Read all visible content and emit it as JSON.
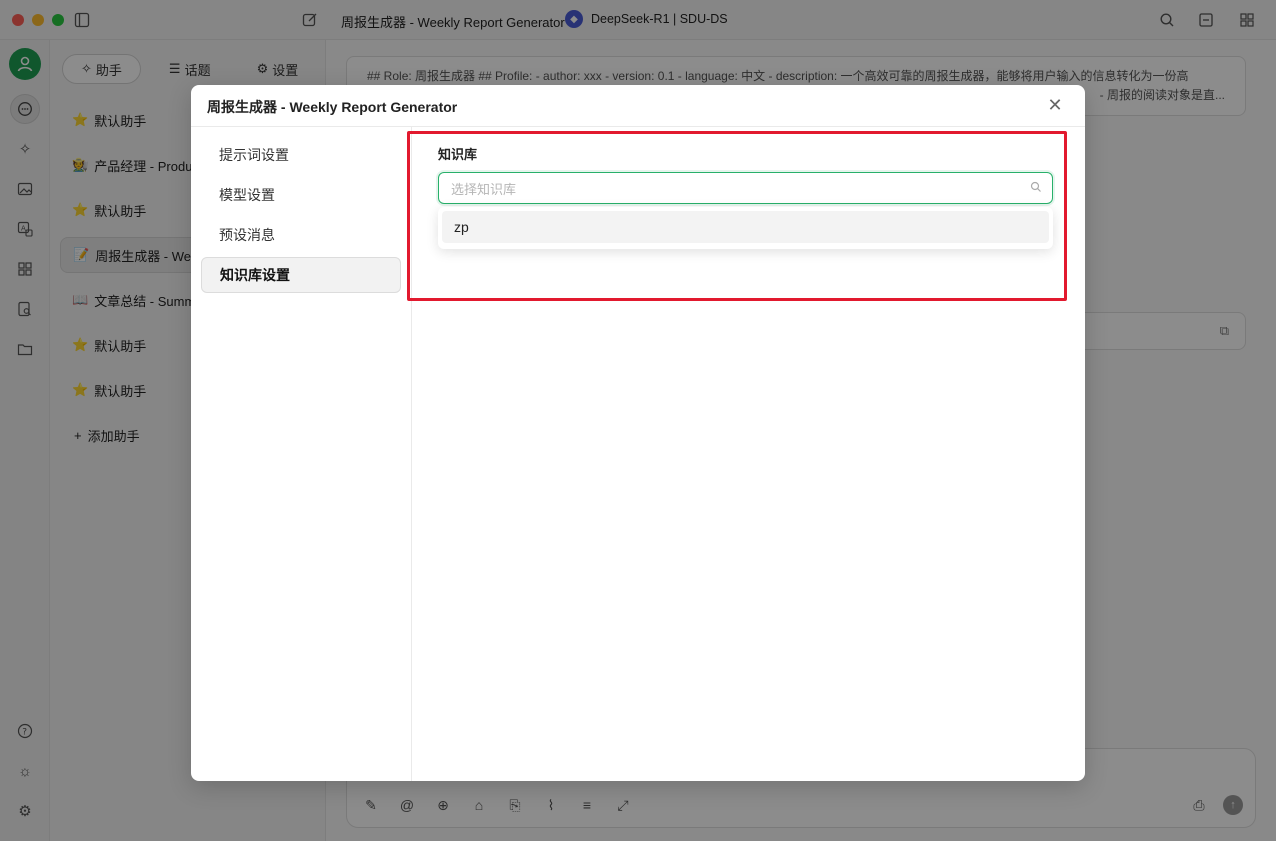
{
  "titlebar": {
    "title": "周报生成器 - Weekly Report Generator",
    "model_label": "DeepSeek-R1 | SDU-DS"
  },
  "sidebar": {
    "tabs": [
      {
        "label": "助手",
        "icon": "sparkle-icon"
      },
      {
        "label": "话题",
        "icon": "list-icon"
      },
      {
        "label": "设置",
        "icon": "gear-icon"
      }
    ],
    "items": [
      {
        "emoji": "⭐",
        "label": "默认助手"
      },
      {
        "emoji": "🧑‍🌾",
        "label": "产品经理 - Produc"
      },
      {
        "emoji": "⭐",
        "label": "默认助手"
      },
      {
        "emoji": "📝",
        "label": "周报生成器 - Wee"
      },
      {
        "emoji": "📖",
        "label": "文章总结 - Summa"
      },
      {
        "emoji": "⭐",
        "label": "默认助手"
      },
      {
        "emoji": "⭐",
        "label": "默认助手"
      }
    ],
    "add_label": "添加助手"
  },
  "main": {
    "prompt_line1": "## Role: 周报生成器 ## Profile: - author: xxx - version: 0.1 - language: 中文 - description: 一个高效可靠的周报生成器，能够将用户输入的信息转化为一份高",
    "prompt_line2": "- 周报的阅读对象是直..."
  },
  "modal": {
    "title": "周报生成器 - Weekly Report Generator",
    "nav": [
      {
        "label": "提示词设置"
      },
      {
        "label": "模型设置"
      },
      {
        "label": "预设消息"
      },
      {
        "label": "知识库设置"
      }
    ],
    "active_nav": "知识库设置",
    "kb_label": "知识库",
    "kb_placeholder": "选择知识库",
    "kb_options": [
      "zp"
    ]
  },
  "colors": {
    "accent": "#28b06a",
    "highlight": "#e2192e",
    "avatar": "#1e9e52"
  }
}
